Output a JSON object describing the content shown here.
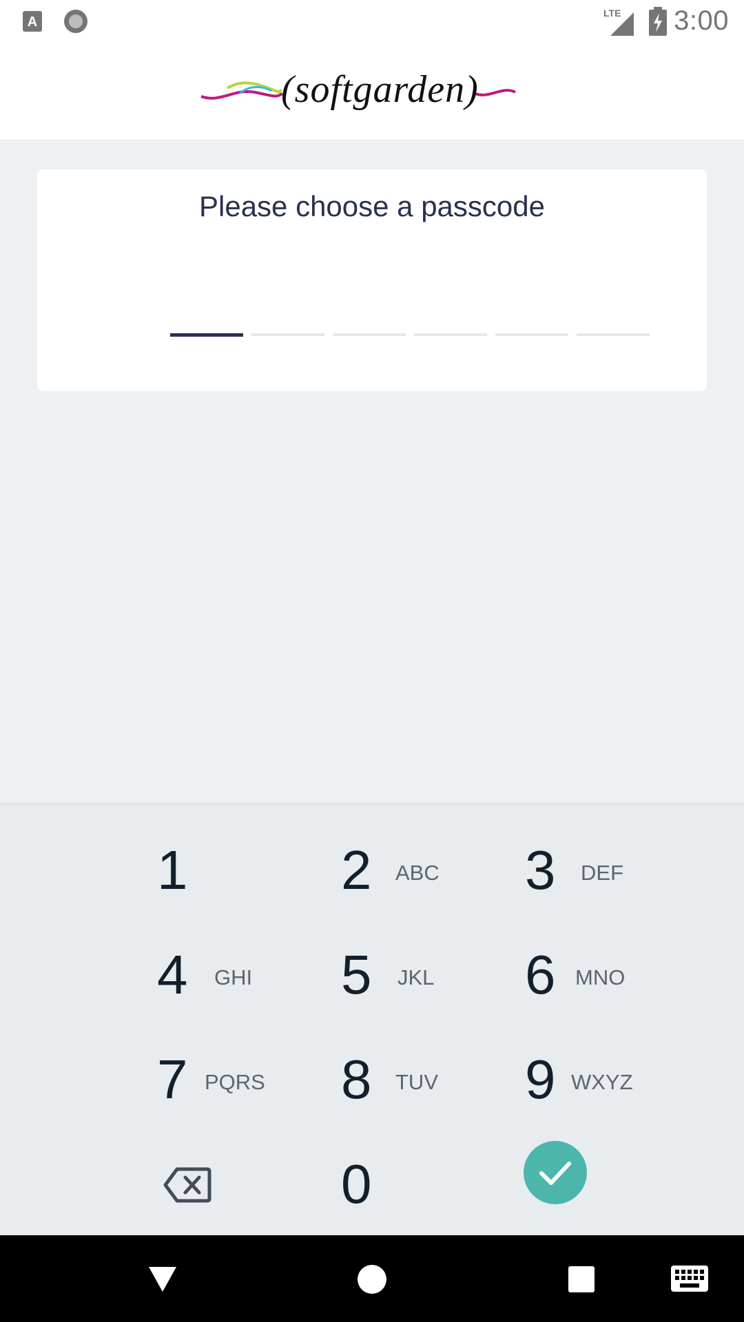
{
  "status_bar": {
    "time": "3:00",
    "network": "LTE",
    "icons": [
      "app-notification-icon",
      "circle-notification-icon",
      "signal-icon",
      "battery-charging-icon"
    ]
  },
  "header": {
    "logo_text": "(softgarden)"
  },
  "card": {
    "title": "Please choose a passcode",
    "slots": [
      {
        "filled": false,
        "active": true
      },
      {
        "filled": false,
        "active": false
      },
      {
        "filled": false,
        "active": false
      },
      {
        "filled": false,
        "active": false
      },
      {
        "filled": false,
        "active": false
      },
      {
        "filled": false,
        "active": false
      }
    ]
  },
  "keypad": {
    "keys": [
      {
        "digit": "1",
        "letters": ""
      },
      {
        "digit": "2",
        "letters": "ABC"
      },
      {
        "digit": "3",
        "letters": "DEF"
      },
      {
        "digit": "4",
        "letters": "GHI"
      },
      {
        "digit": "5",
        "letters": "JKL"
      },
      {
        "digit": "6",
        "letters": "MNO"
      },
      {
        "digit": "7",
        "letters": "PQRS"
      },
      {
        "digit": "8",
        "letters": "TUV"
      },
      {
        "digit": "9",
        "letters": "WXYZ"
      },
      {
        "digit": "0",
        "letters": ""
      }
    ],
    "delete_icon": "backspace-icon",
    "confirm_icon": "check-icon"
  },
  "colors": {
    "accent": "#4db6ac",
    "title": "#2a3050",
    "background": "#eef1f3"
  },
  "nav_bar": {
    "icons": [
      "back-icon",
      "home-icon",
      "recents-icon",
      "keyboard-icon"
    ]
  }
}
